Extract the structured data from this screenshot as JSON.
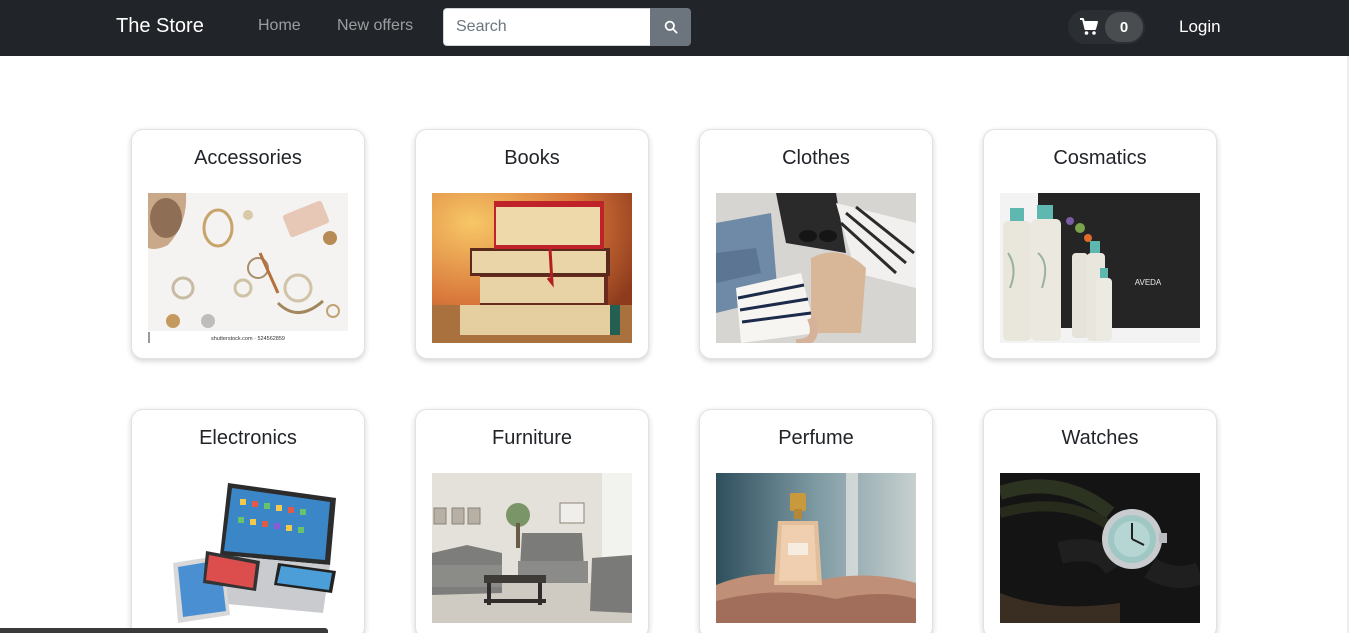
{
  "navbar": {
    "brand": "The Store",
    "links": [
      "Home",
      "New offers"
    ],
    "search_placeholder": "Search",
    "cart_count": "0",
    "login_label": "Login"
  },
  "categories": [
    {
      "title": "Accessories",
      "caption": "shutterstock.com · 524562859"
    },
    {
      "title": "Books"
    },
    {
      "title": "Clothes"
    },
    {
      "title": "Cosmatics",
      "brand_text": "AVEDA"
    },
    {
      "title": "Electronics"
    },
    {
      "title": "Furniture"
    },
    {
      "title": "Perfume"
    },
    {
      "title": "Watches"
    }
  ],
  "colors": {
    "navbar_bg": "#212529",
    "search_button": "#6c757d",
    "card_border": "#e2e2e2"
  }
}
